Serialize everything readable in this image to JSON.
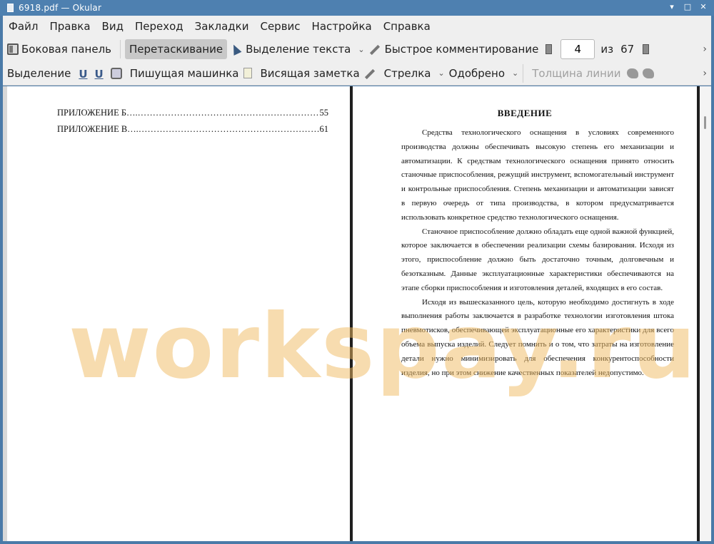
{
  "window": {
    "title": "6918.pdf  — Okular",
    "minimize": "▾",
    "maximize": "□",
    "close": "✕"
  },
  "menu": [
    "Файл",
    "Правка",
    "Вид",
    "Переход",
    "Закладки",
    "Сервис",
    "Настройка",
    "Справка"
  ],
  "toolbar1": {
    "sidebar": "Боковая панель",
    "browse": "Перетаскивание",
    "text_select": "Выделение текста",
    "quick_annot": "Быстрое комментирование",
    "page_current": "4",
    "page_of": "из",
    "page_total": "67"
  },
  "toolbar2": {
    "highlight": "Выделение",
    "typewriter": "Пишущая машинка",
    "popup_note": "Висящая заметка",
    "arrow": "Стрелка",
    "stamp": "Одобрено",
    "line_width": "Толщина линии"
  },
  "left_page": {
    "toc": [
      {
        "label": "ПРИЛОЖЕНИЕ Б….",
        "dots": "……………………………………………………………..",
        "page": "55"
      },
      {
        "label": "ПРИЛОЖЕНИЕ В….",
        "dots": "……………………………………………………………..",
        "page": "61"
      }
    ]
  },
  "right_page": {
    "heading": "ВВЕДЕНИЕ",
    "paragraphs": [
      "Средства технологического оснащения в условиях современного производства должны обеспечивать высокую степень его механизации и автоматизации. К средствам технологического оснащения принято относить станочные приспособления, режущий инструмент, вспомогательный инструмент и контрольные приспособления. Степень механизации и автоматизации зависят в первую очередь от типа производства, в котором предусматривается использовать конкретное средство технологического оснащения.",
      "Станочное приспособление должно обладать еще одной важной функцией, которое заключается в обеспечении реализации схемы базирования. Исходя из этого, приспособление должно быть достаточно точным, долговечным и безотказным. Данные эксплуатационные характеристики обеспечиваются на этапе сборки приспособления и изготовления деталей, входящих в его состав.",
      "Исходя из вышесказанного цель, которую необходимо достигнуть в ходе выполнения работы заключается в разработке технологии изготовления штока пневмотисков, обеспечивающей эксплуатационные его характеристики для всего объема выпуска изделий. Следует помнить и о том, что затраты на изготовление детали нужно минимизировать для обеспечения конкурентоспособности изделия, но при этом снижение качественных показателей недопустимо."
    ]
  },
  "watermark": "workspay.ru"
}
